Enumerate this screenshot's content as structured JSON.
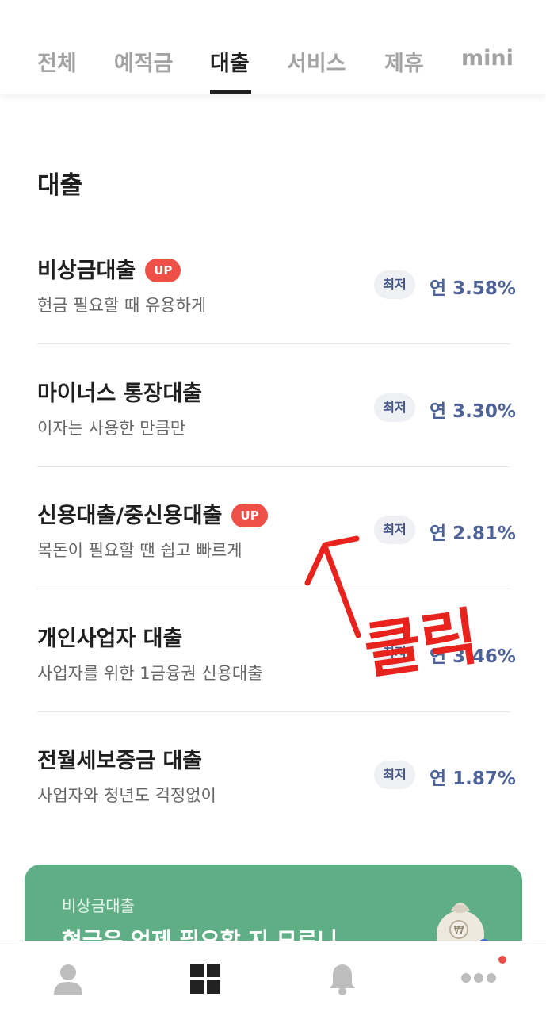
{
  "tabs": [
    {
      "label": "전체",
      "active": false
    },
    {
      "label": "예적금",
      "active": false
    },
    {
      "label": "대출",
      "active": true
    },
    {
      "label": "서비스",
      "active": false
    },
    {
      "label": "제휴",
      "active": false
    },
    {
      "label": "mini",
      "active": false
    }
  ],
  "section_title": "대출",
  "loans": [
    {
      "title": "비상금대출",
      "badge": "UP",
      "subtitle": "현금 필요할 때 유용하게",
      "min_label": "최저",
      "rate": "연 3.58%"
    },
    {
      "title": "마이너스 통장대출",
      "badge": null,
      "subtitle": "이자는 사용한 만큼만",
      "min_label": "최저",
      "rate": "연 3.30%"
    },
    {
      "title": "신용대출/중신용대출",
      "badge": "UP",
      "subtitle": "목돈이 필요할 땐 쉽고 빠르게",
      "min_label": "최저",
      "rate": "연 2.81%"
    },
    {
      "title": "개인사업자 대출",
      "badge": null,
      "subtitle": "사업자를 위한 1금융권 신용대출",
      "min_label": "최저",
      "rate": "연 3.46%"
    },
    {
      "title": "전월세보증금 대출",
      "badge": null,
      "subtitle": "사업자와 청년도 걱정없이",
      "min_label": "최저",
      "rate": "연 1.87%"
    }
  ],
  "annotation": {
    "text": "클릭",
    "color": "#e8231e"
  },
  "promo": {
    "small": "비상금대출",
    "big": "현금은 언제 필요할 지 모르니",
    "bg": "#5fae86",
    "icon": "money-bag-icon"
  },
  "bottom_nav": [
    {
      "icon": "person-icon"
    },
    {
      "icon": "grid-icon",
      "active": true
    },
    {
      "icon": "bell-icon"
    },
    {
      "icon": "more-icon",
      "notification_dot": true
    }
  ],
  "colors": {
    "accent_rate": "#4d6398",
    "up_badge": "#ee5047",
    "tab_inactive": "#a3a3a3"
  }
}
